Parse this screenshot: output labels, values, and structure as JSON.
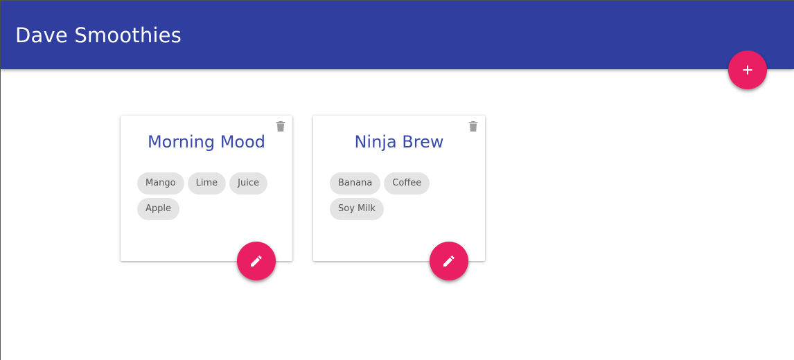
{
  "app": {
    "title": "Dave Smoothies"
  },
  "add_button": {
    "icon": "plus-icon"
  },
  "smoothies": [
    {
      "title": "Morning Mood",
      "ingredients": [
        "Mango",
        "Lime",
        "Juice",
        "Apple"
      ]
    },
    {
      "title": "Ninja Brew",
      "ingredients": [
        "Banana",
        "Coffee",
        "Soy Milk"
      ]
    }
  ],
  "colors": {
    "primary": "#303f9f",
    "title_text": "#3949ab",
    "accent": "#e91e63",
    "chip_bg": "#e4e4e4",
    "delete_icon": "#9e9e9e"
  },
  "icons": {
    "delete": "trash-icon",
    "edit": "pencil-icon"
  }
}
